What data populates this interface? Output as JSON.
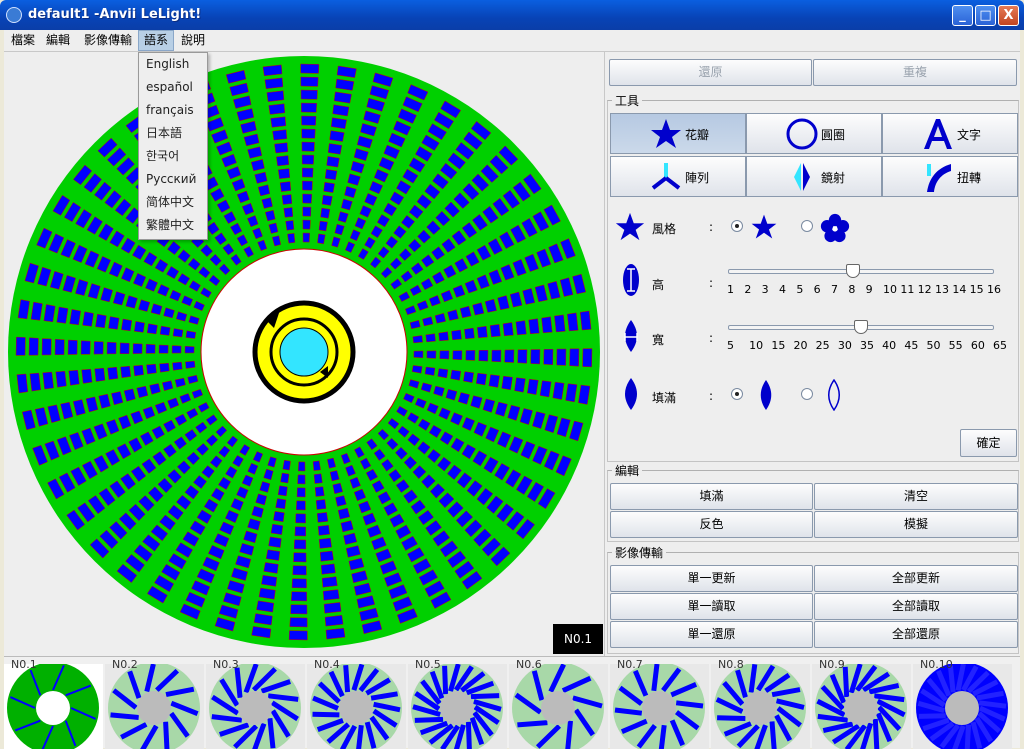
{
  "window": {
    "title": "default1 -Anvii LeLight!",
    "buttons": [
      "_",
      "□",
      "X"
    ]
  },
  "menubar": {
    "items": [
      "檔案",
      "編輯",
      "影像傳輸",
      "語系",
      "說明"
    ],
    "active_index": 3
  },
  "language_menu": {
    "options": [
      "English",
      "español",
      "français",
      "日本語",
      "한국어",
      "Русский",
      "简体中文",
      "繁體中文"
    ]
  },
  "canvas": {
    "slot_label": "N0.1"
  },
  "panel": {
    "undo_label": "還原",
    "redo_label": "重複",
    "tools": {
      "title": "工具",
      "buttons": [
        {
          "label": "花瓣",
          "icon": "flower-star-icon"
        },
        {
          "label": "圓圈",
          "icon": "circle-icon"
        },
        {
          "label": "文字",
          "icon": "letter-a-icon"
        },
        {
          "label": "陣列",
          "icon": "array-tripod-icon"
        },
        {
          "label": "鏡射",
          "icon": "mirror-icon"
        },
        {
          "label": "扭轉",
          "icon": "twist-icon"
        }
      ],
      "style_label": "風格",
      "height_label": "高",
      "height_ticks": [
        "1",
        "2",
        "3",
        "4",
        "5",
        "6",
        "7",
        "8",
        "9",
        "10",
        "11",
        "12",
        "13",
        "14",
        "15",
        "16"
      ],
      "height_value": 8,
      "width_label": "寬",
      "width_ticks": [
        "5",
        "10",
        "15",
        "20",
        "25",
        "30",
        "35",
        "40",
        "45",
        "50",
        "55",
        "60",
        "65"
      ],
      "width_value": 35,
      "fill_label": "填滿",
      "colon": ":",
      "confirm_label": "確定"
    },
    "edit": {
      "title": "編輯",
      "buttons": [
        "填滿",
        "清空",
        "反色",
        "模擬"
      ]
    },
    "transfer": {
      "title": "影像傳輸",
      "buttons": [
        "單一更新",
        "全部更新",
        "單一讀取",
        "全部讀取",
        "單一還原",
        "全部還原"
      ]
    }
  },
  "thumbnails": [
    "N0.1",
    "N0.2",
    "N0.3",
    "N0.4",
    "N0.5",
    "N0.6",
    "N0.7",
    "N0.8",
    "N0.9",
    "N0.10"
  ],
  "colors": {
    "green": "#00d000",
    "blue": "#0000ff",
    "yellow": "#ffff00",
    "cyan": "#33e5ff",
    "red": "#cc0000"
  }
}
